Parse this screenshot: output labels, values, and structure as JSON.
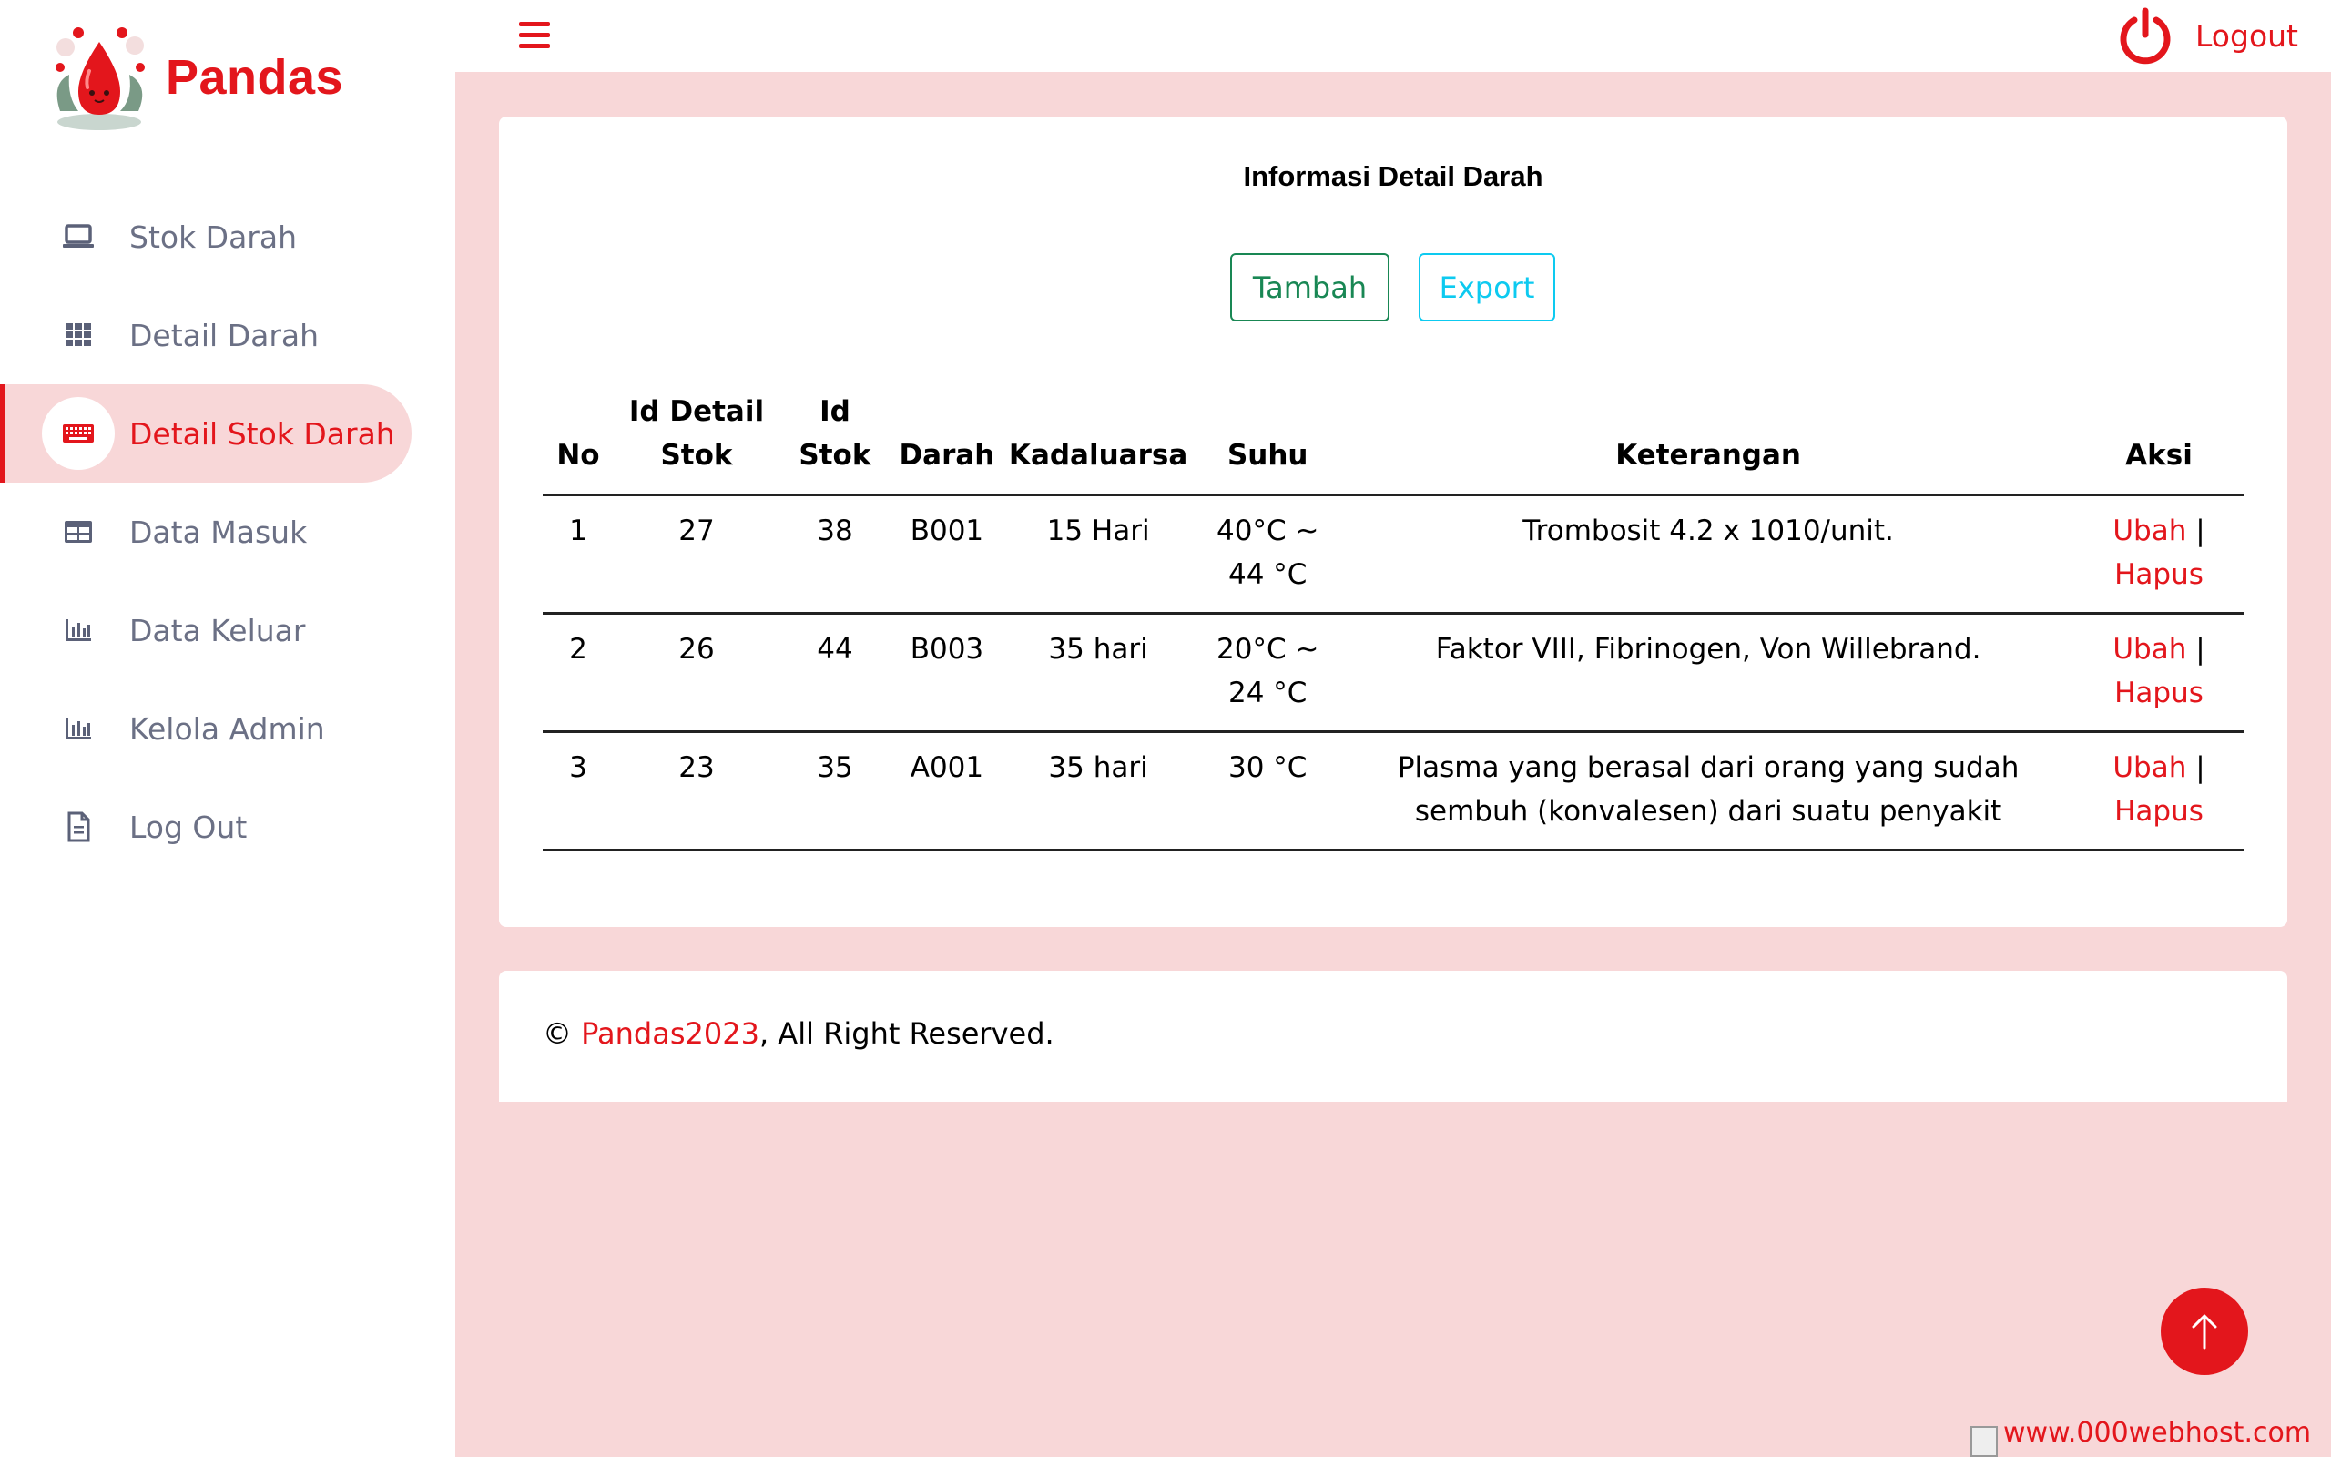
{
  "brand": {
    "name": "Pandas"
  },
  "sidebar": {
    "items": [
      {
        "label": "Stok Darah",
        "icon": "laptop-icon",
        "active": false
      },
      {
        "label": "Detail Darah",
        "icon": "grid-icon",
        "active": false
      },
      {
        "label": "Detail Stok Darah",
        "icon": "keyboard-icon",
        "active": true
      },
      {
        "label": "Data Masuk",
        "icon": "table-icon",
        "active": false
      },
      {
        "label": "Data Keluar",
        "icon": "bar-chart-icon",
        "active": false
      },
      {
        "label": "Kelola Admin",
        "icon": "bar-chart-icon",
        "active": false
      },
      {
        "label": "Log Out",
        "icon": "document-icon",
        "active": false
      }
    ]
  },
  "topbar": {
    "logout_label": "Logout"
  },
  "main": {
    "title": "Informasi Detail Darah",
    "add_label": "Tambah",
    "export_label": "Export",
    "columns": [
      "No",
      "Id Detail Stok",
      "Id Stok",
      "Darah",
      "Kadaluarsa",
      "Suhu",
      "Keterangan",
      "Aksi"
    ],
    "rows": [
      {
        "no": "1",
        "id_detail": "27",
        "id_stok": "38",
        "darah": "B001",
        "kadaluarsa": "15 Hari",
        "suhu": "40°C ~ 44 °C",
        "keterangan": "Trombosit 4.2 x 1010/unit."
      },
      {
        "no": "2",
        "id_detail": "26",
        "id_stok": "44",
        "darah": "B003",
        "kadaluarsa": "35 hari",
        "suhu": "20°C ~ 24 °C",
        "keterangan": "Faktor VIII, Fibrinogen, Von Willebrand."
      },
      {
        "no": "3",
        "id_detail": "23",
        "id_stok": "35",
        "darah": "A001",
        "kadaluarsa": "35 hari",
        "suhu": "30 °C",
        "keterangan": "Plasma yang berasal dari orang yang sudah sembuh (konvalesen) dari suatu penyakit"
      }
    ],
    "action_edit": "Ubah",
    "action_sep": "|",
    "action_delete": "Hapus"
  },
  "footer": {
    "copyright": "©",
    "brand_link": "Pandas2023",
    "rest": ", All Right Reserved."
  },
  "webhost_text": "www.000webhost.com",
  "colors": {
    "accent": "#e3161c",
    "background": "#f8d7d8",
    "success": "#198754",
    "info": "#0dcaf0"
  }
}
